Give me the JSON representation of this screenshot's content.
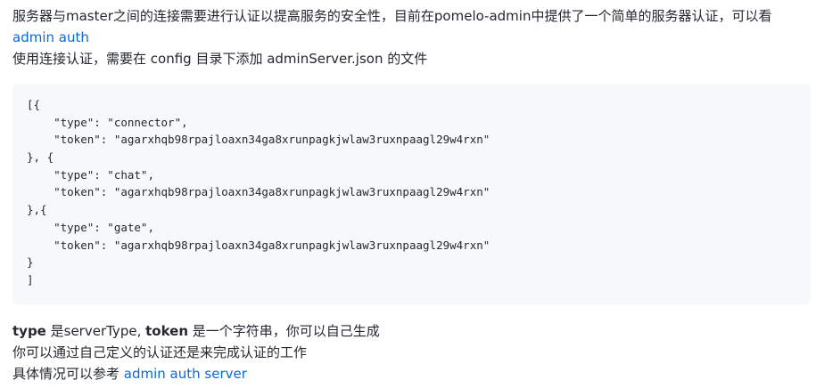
{
  "intro": {
    "line1": "服务器与master之间的连接需要进行认证以提高服务的安全性，目前在pomelo-admin中提供了一个简单的服务器认证，可以看",
    "link1": "admin auth",
    "line2": "使用连接认证，需要在 config 目录下添加 adminServer.json 的文件"
  },
  "code": {
    "lines": [
      "[{",
      "    \"type\": \"connector\",",
      "    \"token\": \"agarxhqb98rpajloaxn34ga8xrunpagkjwlaw3ruxnpaagl29w4rxn\"",
      "}, {",
      "    \"type\": \"chat\",",
      "    \"token\": \"agarxhqb98rpajloaxn34ga8xrunpagkjwlaw3ruxnpaagl29w4rxn\"",
      "},{",
      "    \"type\": \"gate\",",
      "    \"token\": \"agarxhqb98rpajloaxn34ga8xrunpagkjwlaw3ruxnpaagl29w4rxn\"",
      "}",
      "]"
    ]
  },
  "outro": {
    "type_kw": "type",
    "type_text": " 是serverType, ",
    "token_kw": "token",
    "token_text": " 是一个字符串，你可以自己生成",
    "line2": "你可以通过自己定义的认证还是来完成认证的工作",
    "line3_prefix": "具体情况可以参考 ",
    "link2": "admin auth server"
  }
}
